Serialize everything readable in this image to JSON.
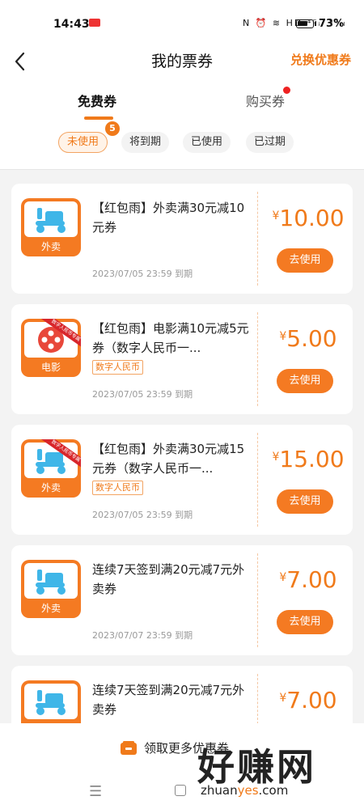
{
  "status_bar": {
    "time": "14:43",
    "icons": "N ⏰ ≋ HD ⁴ᴳᵢₗ ⁵ᴳᵢₗ",
    "battery_percent": "73%",
    "battery_level": 0.73
  },
  "header": {
    "title": "我的票券",
    "action": "兑换优惠券"
  },
  "tabs": {
    "free": "免费券",
    "buy": "购买券"
  },
  "filters": {
    "unused": "未使用",
    "unused_badge": "5",
    "soon": "将到期",
    "used": "已使用",
    "expired": "已过期"
  },
  "coupons": [
    {
      "category": "外卖",
      "title": "【红包雨】外卖满30元减10元券",
      "tag": "",
      "date": "2023/07/05 23:59 到期",
      "price": "10.00",
      "currency": "¥",
      "button": "去使用",
      "ribbon": ""
    },
    {
      "category": "电影",
      "title": "【红包雨】电影满10元减5元券（数字人民币一...",
      "tag": "数字人民币",
      "date": "2023/07/05 23:59 到期",
      "price": "5.00",
      "currency": "¥",
      "button": "去使用",
      "ribbon": "数字人民币专属"
    },
    {
      "category": "外卖",
      "title": "【红包雨】外卖满30元减15元券（数字人民币一...",
      "tag": "数字人民币",
      "date": "2023/07/05 23:59 到期",
      "price": "15.00",
      "currency": "¥",
      "button": "去使用",
      "ribbon": "数字人民币专属"
    },
    {
      "category": "外卖",
      "title": "连续7天签到满20元减7元外卖券",
      "tag": "",
      "date": "2023/07/07 23:59 到期",
      "price": "7.00",
      "currency": "¥",
      "button": "去使用",
      "ribbon": ""
    },
    {
      "category": "外卖",
      "title": "连续7天签到满20元减7元外卖券",
      "tag": "",
      "date": "",
      "price": "7.00",
      "currency": "¥",
      "button": "",
      "ribbon": ""
    }
  ],
  "bottom_bar": {
    "label": "领取更多优惠券"
  },
  "watermark": {
    "text": "好赚网",
    "url_pre": "zhuan",
    "url_hl": "yes",
    "url_post": ".com"
  },
  "colors": {
    "accent": "#f07a1a",
    "badge_red": "#e22222"
  },
  "icons": {
    "back": "chevron-left-icon",
    "scooter": "scooter-icon",
    "film": "film-reel-icon",
    "gift": "ticket-icon"
  }
}
